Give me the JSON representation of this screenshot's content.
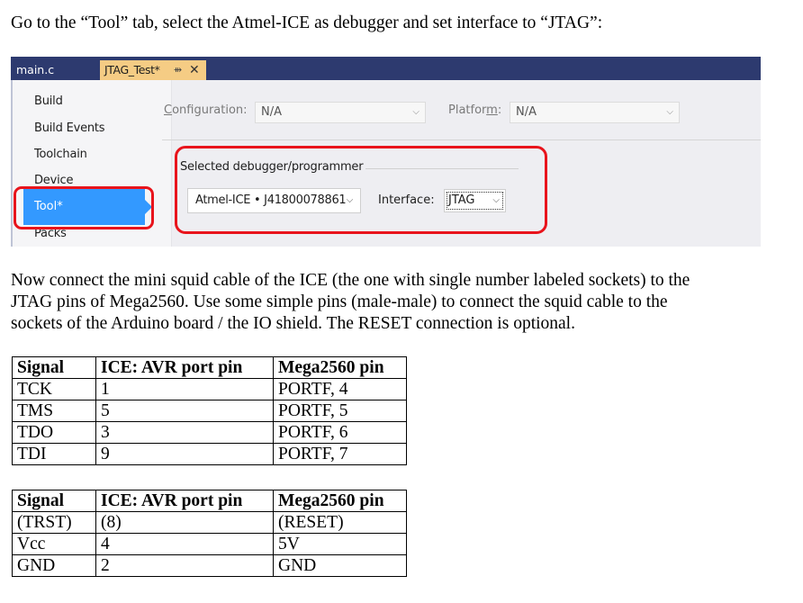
{
  "intro_text": "Go to the “Tool” tab, select the Atmel-ICE as debugger and set interface to “JTAG”:",
  "ide": {
    "tabs": [
      {
        "label": "main.c"
      },
      {
        "label": "JTAG_Test*",
        "pin_icon": "pin-icon",
        "close_icon": "close-icon"
      }
    ],
    "nav_items": [
      "Build",
      "Build Events",
      "Toolchain",
      "Device",
      "Tool*",
      "Packs"
    ],
    "configuration_label": "Configuration:",
    "configuration_value": "N/A",
    "platform_label": "Platform:",
    "platform_value": "N/A",
    "group_label": "Selected debugger/programmer",
    "debugger_value": "Atmel-ICE • J41800078861",
    "interface_label": "Interface:",
    "interface_value": "JTAG",
    "highlight_color": "#e8141c",
    "selected_color": "#3399ff",
    "tabbar_color": "#2d3a6f",
    "active_tab_color": "#f5cc84"
  },
  "paragraph_lines": [
    "Now connect the mini squid cable of the ICE (the one with single number labeled sockets) to the",
    "JTAG pins of Mega2560. Use some simple pins (male-male) to connect the squid cable to the",
    "sockets of the Arduino board / the IO shield. The RESET connection is optional."
  ],
  "table1": {
    "headers": [
      "Signal",
      "ICE: AVR port pin",
      "Mega2560 pin"
    ],
    "rows": [
      [
        "TCK",
        "1",
        "PORTF, 4"
      ],
      [
        "TMS",
        "5",
        "PORTF, 5"
      ],
      [
        "TDO",
        "3",
        "PORTF, 6"
      ],
      [
        "TDI",
        "9",
        "PORTF, 7"
      ]
    ]
  },
  "table2": {
    "headers": [
      "Signal",
      "ICE: AVR port pin",
      "Mega2560 pin"
    ],
    "rows": [
      [
        "(TRST)",
        "(8)",
        "(RESET)"
      ],
      [
        "Vcc",
        "4",
        "5V"
      ],
      [
        "GND",
        "2",
        "GND"
      ]
    ]
  }
}
